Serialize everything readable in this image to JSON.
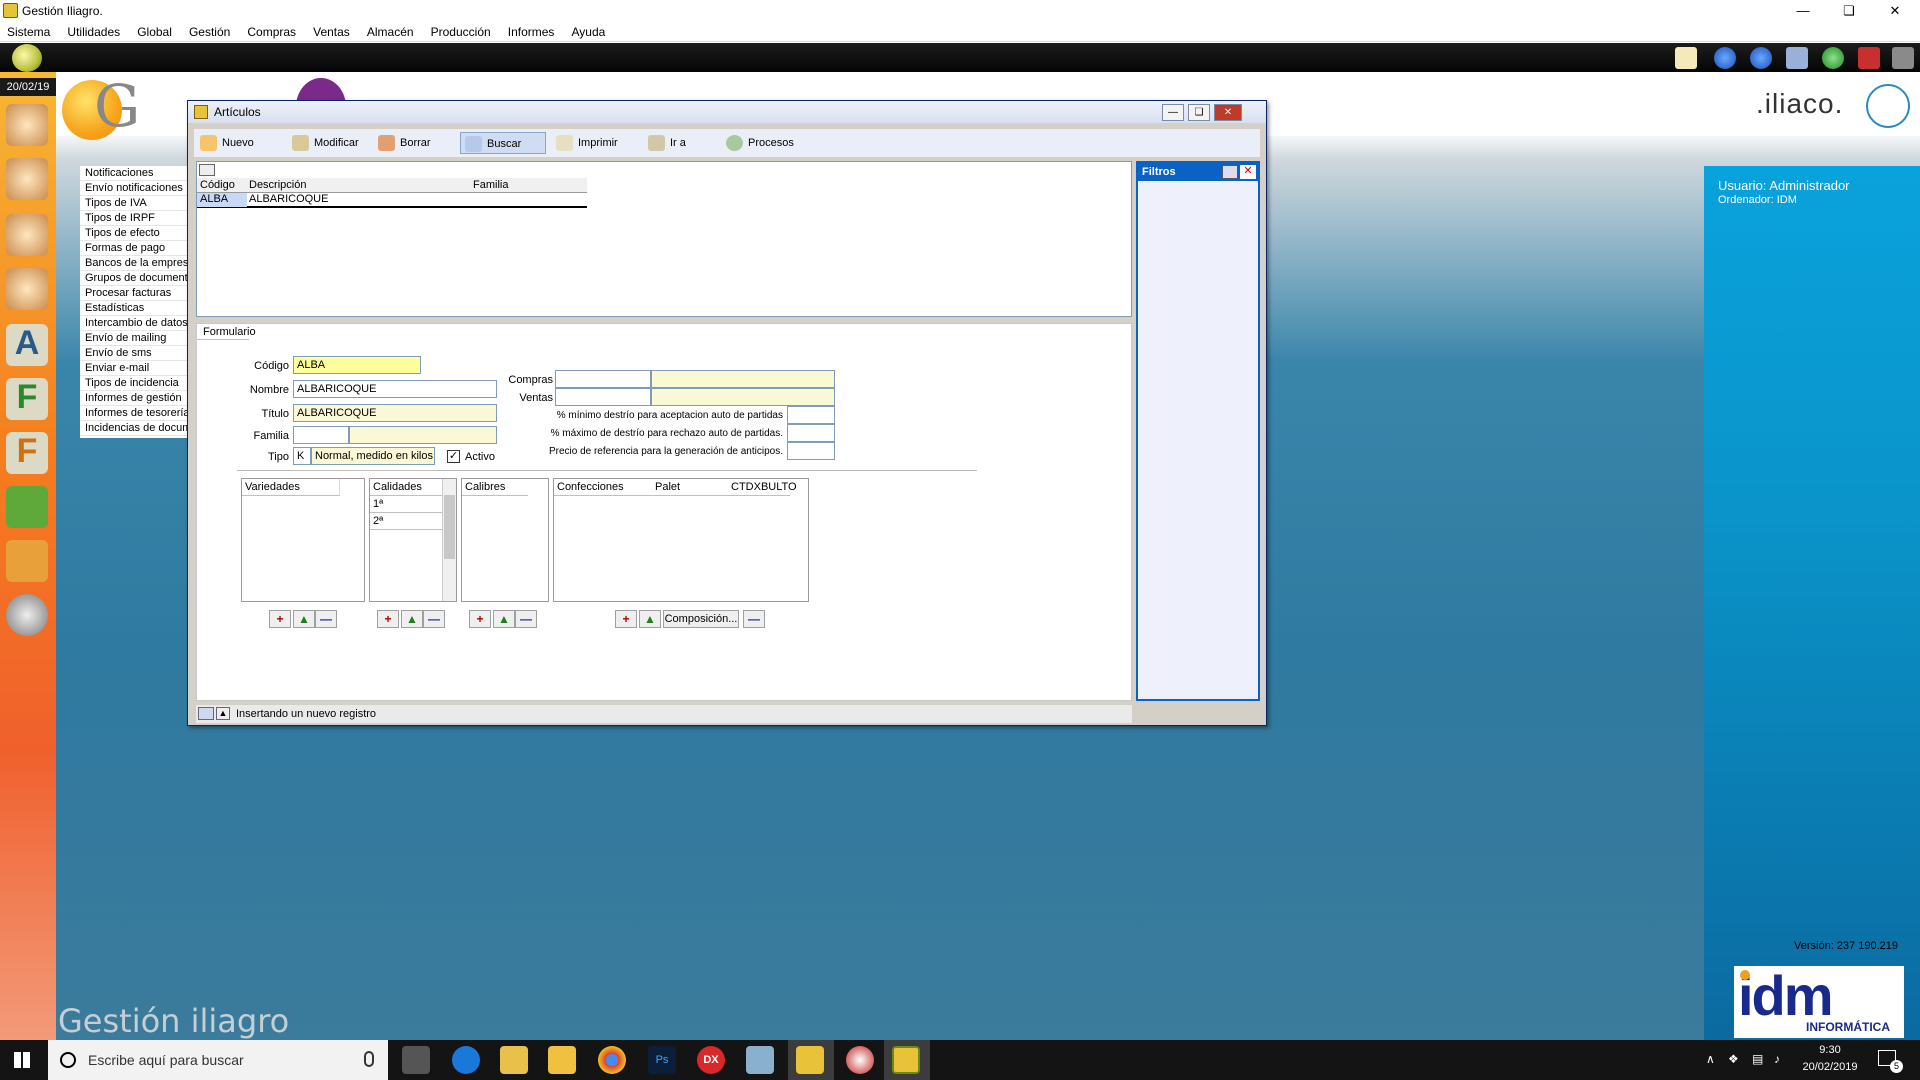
{
  "window": {
    "title": "Gestión Iliagro."
  },
  "menu": [
    "Sistema",
    "Utilidades",
    "Global",
    "Gestión",
    "Compras",
    "Ventas",
    "Almacén",
    "Producción",
    "Informes",
    "Ayuda"
  ],
  "date": "20/02/19",
  "logo_text": ".iliaco.",
  "nav_items": [
    "Notificaciones",
    "Envío notificaciones",
    "Tipos de IVA",
    "Tipos de IRPF",
    "Tipos de efecto",
    "Formas de pago",
    "Bancos de la empresa",
    "Grupos de documentos",
    "Procesar facturas",
    "Estadísticas",
    "Intercambio de datos",
    "Envío de mailing",
    "Envío de sms",
    "Enviar e-mail",
    "Tipos de incidencia",
    "Informes de gestión",
    "Informes de tesorería",
    "Incidencias de documentos"
  ],
  "user_panel": {
    "usuario": "Usuario: Administrador",
    "ordenador": "Ordenador:  IDM",
    "version": "Versión: 237 190.219",
    "brand": "idm",
    "brand_sub": "INFORMÁTICA"
  },
  "bottom_text": "Gestión iliagro",
  "dialog": {
    "title": "Artículos",
    "toolbar": [
      "Nuevo",
      "Modificar",
      "Borrar",
      "Buscar",
      "Imprimir",
      "Ir a",
      "Procesos"
    ],
    "grid": {
      "columns": [
        "Código",
        "Descripción",
        "Familia"
      ],
      "rows": [
        [
          "ALBA",
          "ALBARICOQUE",
          ""
        ]
      ]
    },
    "filters_title": "Filtros",
    "tab": "Formulario",
    "form": {
      "codigo_label": "Código",
      "codigo": "ALBA",
      "nombre_label": "Nombre",
      "nombre": "ALBARICOQUE",
      "titulo_label": "Título",
      "titulo": "ALBARICOQUE",
      "familia_label": "Familia",
      "tipo_label": "Tipo",
      "tipo_code": "K",
      "tipo_desc": "Normal, medido en kilos",
      "activo_label": "Activo",
      "activo": true,
      "compras_label": "Compras",
      "ventas_label": "Ventas",
      "min_destrio": "% mínimo destrío para aceptacion auto de partidas",
      "max_destrio": "% máximo de destrío para rechazo auto de partidas.",
      "precio_ref": "Precio de referencia para la generación de anticipos."
    },
    "panels": {
      "variedades": "Variedades",
      "calidades": "Calidades",
      "calidades_rows": [
        "1ª",
        "2ª"
      ],
      "calibres": "Calibres",
      "confecciones": [
        "Confecciones",
        "Palet",
        "CTDXBULTO"
      ]
    },
    "composicion_button": "Composición...",
    "status": "Insertando un nuevo registro"
  },
  "taskbar": {
    "search_placeholder": "Escribe aquí para buscar",
    "time": "9:30",
    "date": "20/02/2019",
    "notif_count": "5"
  },
  "colors": {
    "accent": "#0a62c5",
    "panel_blue": "#0aa2dc",
    "sidebar_orange": "#f57c1f"
  }
}
